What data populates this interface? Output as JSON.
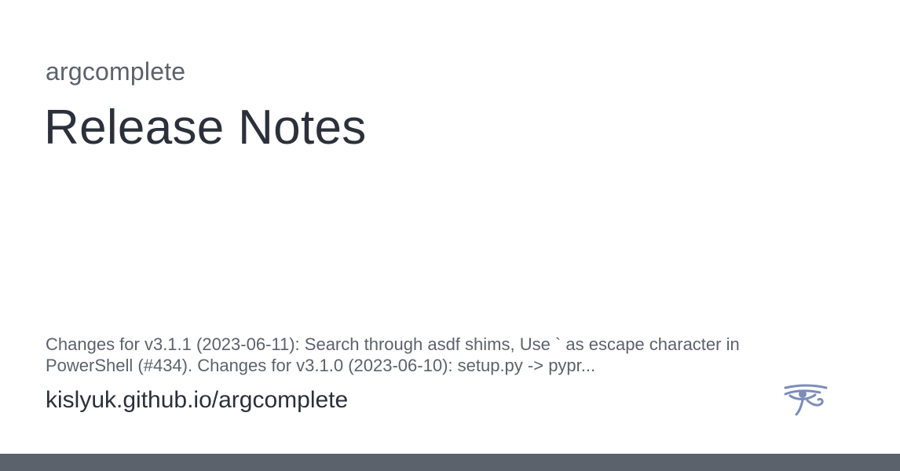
{
  "site": {
    "name": "argcomplete"
  },
  "page": {
    "title": "Release Notes",
    "description": "Changes for v3.1.1 (2023-06-11): Search through asdf shims, Use ` as escape character in PowerShell (#434). Changes for v3.1.0 (2023-06-10): setup.py -> pypr...",
    "url": "kislyuk.github.io/argcomplete"
  },
  "logo": {
    "icon": "eye-of-horus-icon",
    "color": "#7c8db8"
  },
  "colors": {
    "text_primary": "#2b303a",
    "text_secondary": "#5c626c",
    "bar": "#5c626c",
    "background": "#ffffff"
  }
}
